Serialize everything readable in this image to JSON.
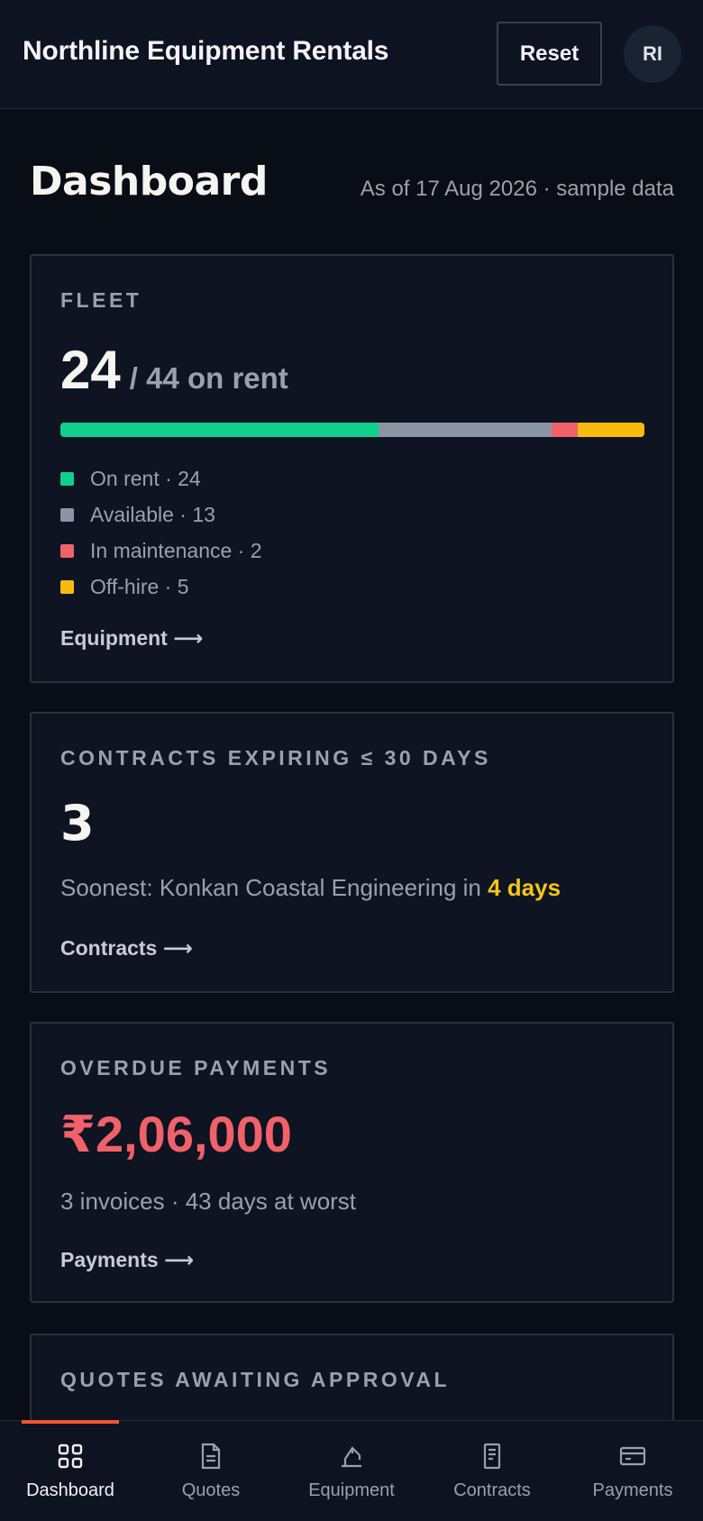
{
  "header": {
    "app_title": "Northline Equipment Rentals",
    "reset_label": "Reset",
    "avatar_initials": "RI"
  },
  "page": {
    "title": "Dashboard",
    "as_of": "As of 17 Aug 2026 · sample data"
  },
  "fleet": {
    "label": "FLEET",
    "on_rent_count": "24",
    "total_text": "/ 44 on rent",
    "segments": [
      {
        "key": "on_rent",
        "label": "On rent · 24",
        "value": 24,
        "color": "#10d08e"
      },
      {
        "key": "available",
        "label": "Available · 13",
        "value": 13,
        "color": "#8b94a3"
      },
      {
        "key": "maintenance",
        "label": "In maintenance · 2",
        "value": 2,
        "color": "#f0616a"
      },
      {
        "key": "off_hire",
        "label": "Off-hire · 5",
        "value": 5,
        "color": "#f7bb10"
      }
    ],
    "link": "Equipment ⟶"
  },
  "contracts": {
    "label": "CONTRACTS EXPIRING ≤ 30 DAYS",
    "count": "3",
    "soonest_prefix": "Soonest: Konkan Coastal Engineering in ",
    "soonest_highlight": "4 days",
    "link": "Contracts ⟶"
  },
  "overdue": {
    "label": "OVERDUE PAYMENTS",
    "amount": "₹2,06,000",
    "subtitle": "3 invoices · 43 days at worst",
    "link": "Payments ⟶"
  },
  "quotes": {
    "label": "QUOTES AWAITING APPROVAL"
  },
  "nav": {
    "items": [
      {
        "label": "Dashboard",
        "icon": "grid-icon",
        "active": true
      },
      {
        "label": "Quotes",
        "icon": "document-icon",
        "active": false
      },
      {
        "label": "Equipment",
        "icon": "crane-icon",
        "active": false
      },
      {
        "label": "Contracts",
        "icon": "contract-icon",
        "active": false
      },
      {
        "label": "Payments",
        "icon": "card-icon",
        "active": false
      }
    ]
  }
}
